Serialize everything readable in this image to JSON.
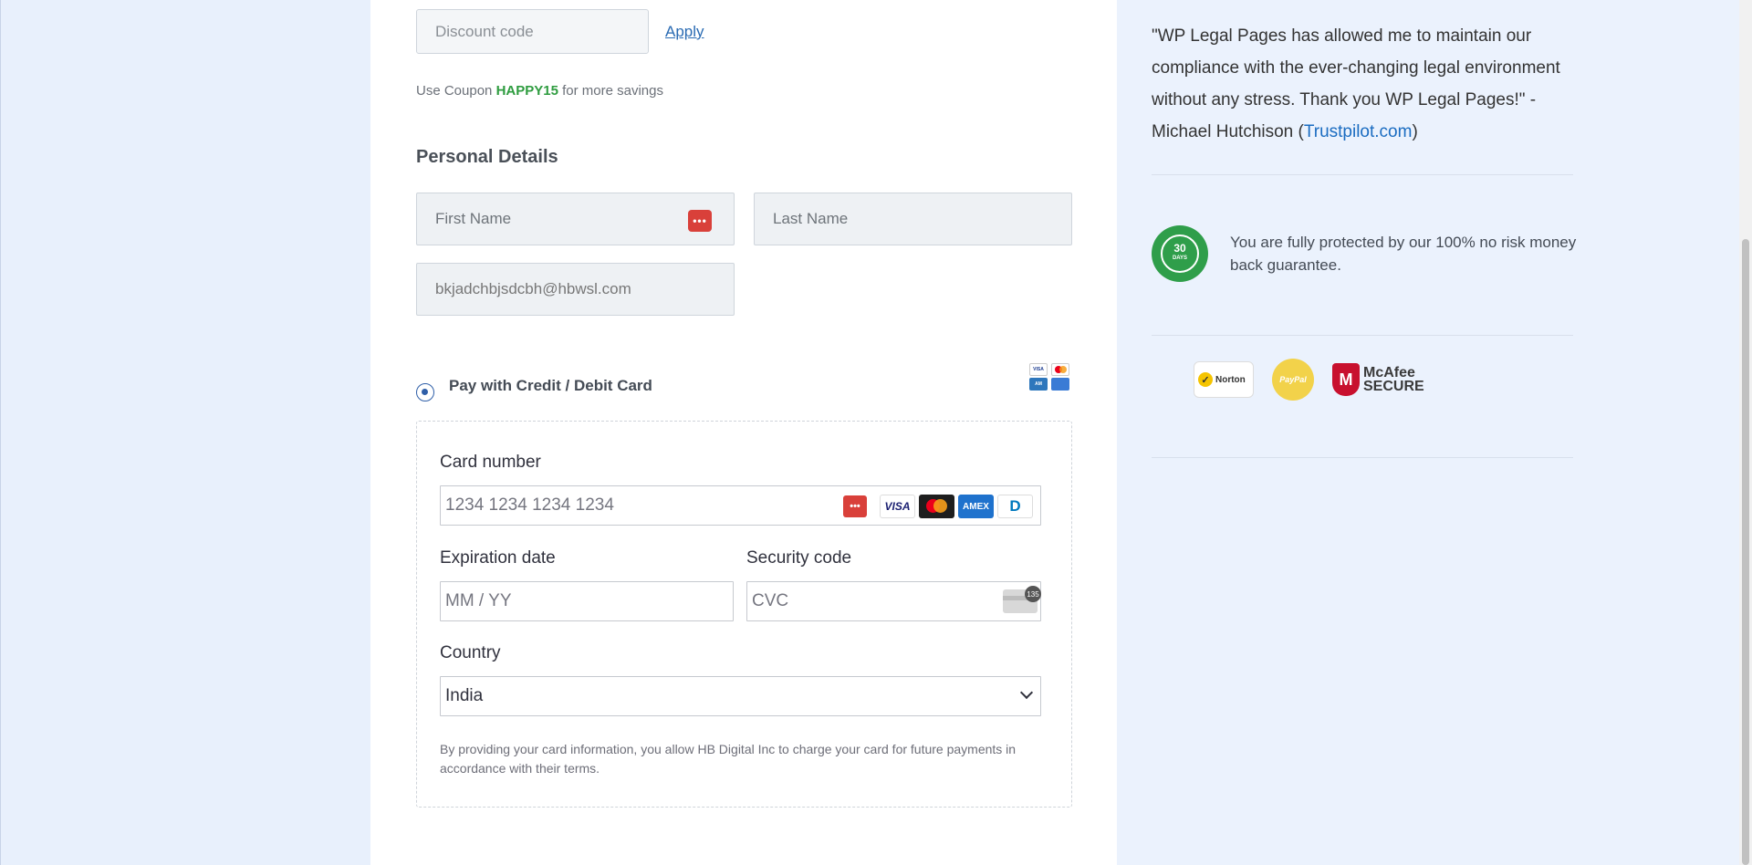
{
  "discount": {
    "placeholder": "Discount code",
    "apply_label": "Apply",
    "note_prefix": "Use Coupon",
    "coupon_code": "HAPPY15",
    "note_suffix": "for more savings"
  },
  "personal": {
    "title": "Personal Details",
    "first_name_placeholder": "First Name",
    "last_name_placeholder": "Last Name",
    "email_value": "bkjadchbjsdcbh@hbwsl.com"
  },
  "payment": {
    "method_label": "Pay with Credit / Debit Card",
    "card_number_label": "Card number",
    "card_number_placeholder": "1234 1234 1234 1234",
    "expiration_label": "Expiration date",
    "expiration_placeholder": "MM / YY",
    "security_label": "Security code",
    "security_placeholder": "CVC",
    "cvc_badge": "135",
    "country_label": "Country",
    "country_value": "India",
    "disclaimer": "By providing your card information, you allow HB Digital Inc to charge your card for future payments in accordance with their terms.",
    "brands": [
      "VISA",
      "AMEX",
      "D"
    ]
  },
  "sidebar": {
    "quote_text": "\"WP Legal Pages has allowed me to maintain our compliance with the ever-changing legal environment without any stress. Thank you WP Legal Pages!\" - Michael Hutchison (",
    "quote_link": "Trustpilot.com",
    "quote_end": ")",
    "badge_number": "30",
    "badge_text": "DAYS",
    "guarantee": "You are fully protected by our 100% no risk money back guarantee.",
    "norton_label": "Norton",
    "paypal_label": "PayPal",
    "mcafee_label_1": "McAfee",
    "mcafee_label_2": "SECURE"
  },
  "colors": {
    "accent_blue": "#2a6bb3",
    "coupon_green": "#2e9c3f",
    "password_icon_red": "#d9403a"
  }
}
